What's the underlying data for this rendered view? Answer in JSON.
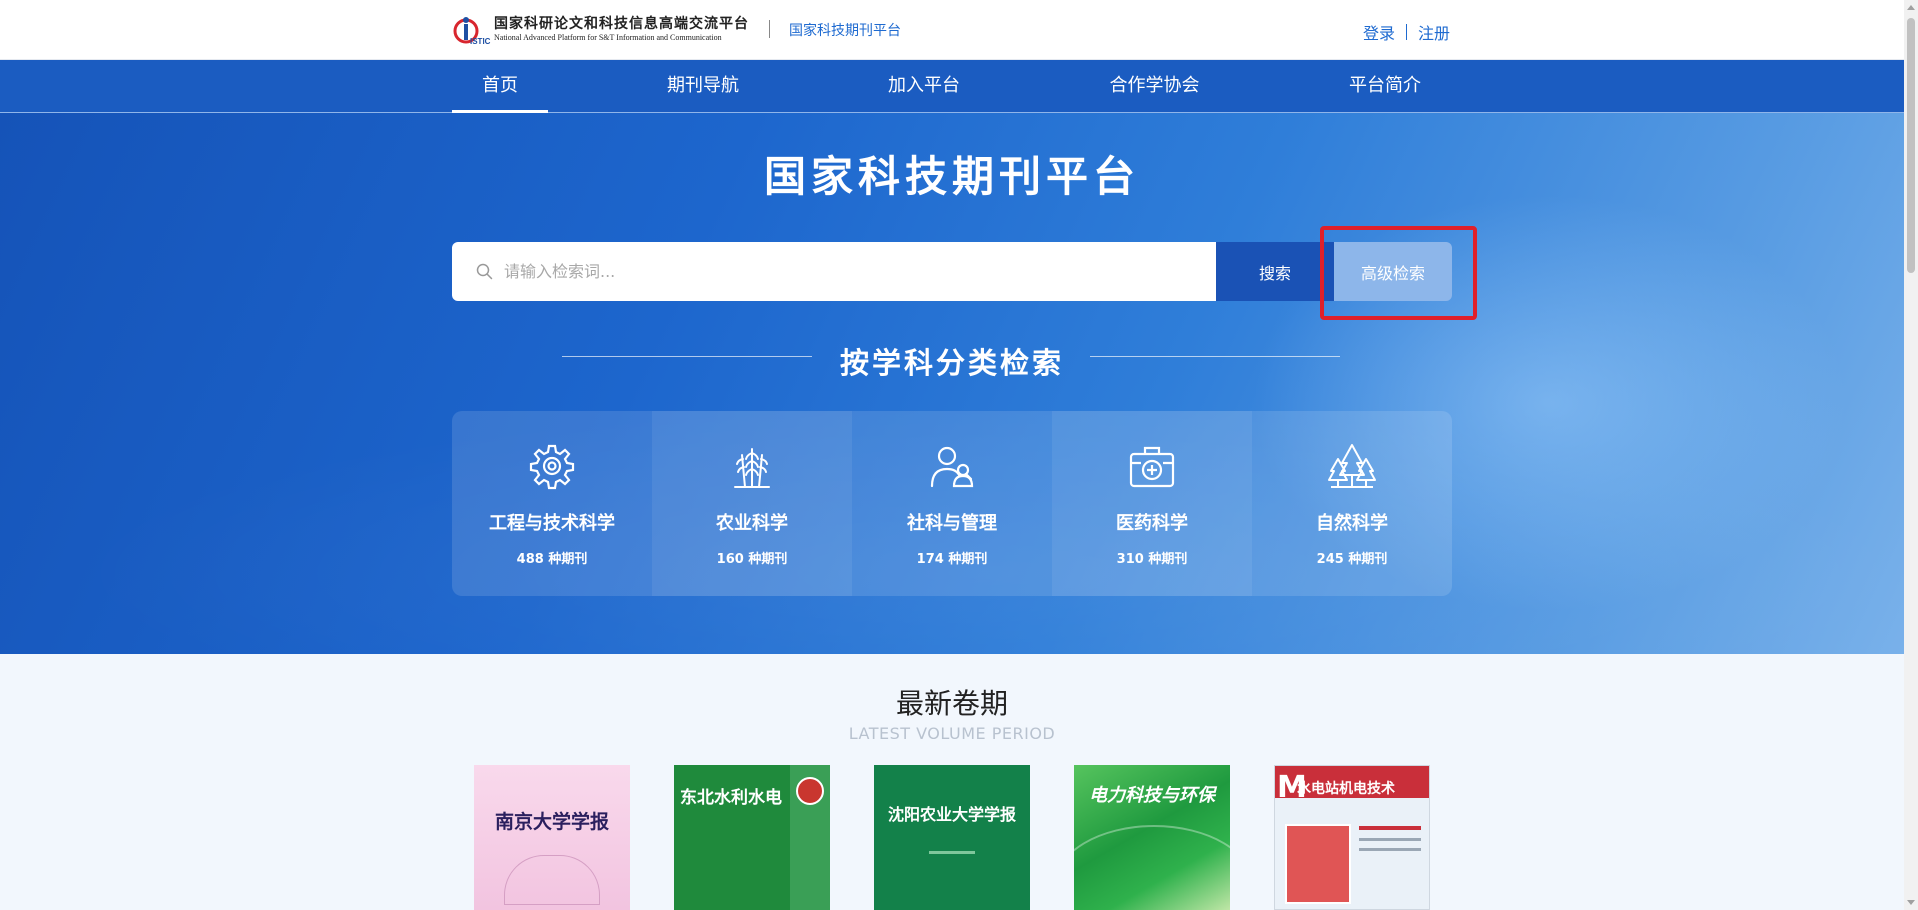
{
  "header": {
    "logo_cn": "国家科研论文和科技信息高端交流平台",
    "logo_en": "National Advanced Platform for S&T Information and Communication",
    "logo_mark": "ISTIC",
    "platform_link": "国家科技期刊平台",
    "login": "登录",
    "register": "注册"
  },
  "nav": {
    "items": [
      "首页",
      "期刊导航",
      "加入平台",
      "合作学协会",
      "平台简介"
    ],
    "active": "首页"
  },
  "hero": {
    "title": "国家科技期刊平台",
    "search_placeholder": "请输入检索词...",
    "search_button": "搜索",
    "advanced_button": "高级检索",
    "subject_heading": "按学科分类检索"
  },
  "categories": [
    {
      "icon": "gear-icon",
      "name": "工程与技术科学",
      "count": "488 种期刊"
    },
    {
      "icon": "wheat-icon",
      "name": "农业科学",
      "count": "160 种期刊"
    },
    {
      "icon": "people-icon",
      "name": "社科与管理",
      "count": "174 种期刊"
    },
    {
      "icon": "medical-kit-icon",
      "name": "医药科学",
      "count": "310 种期刊"
    },
    {
      "icon": "trees-icon",
      "name": "自然科学",
      "count": "245 种期刊"
    }
  ],
  "latest": {
    "title": "最新卷期",
    "subtitle": "LATEST VOLUME PERIOD",
    "covers": [
      {
        "title": "南京大学学报",
        "bg": "#f6cde6"
      },
      {
        "title": "东北水利水电",
        "bg": "#1f8a3c"
      },
      {
        "title": "沈阳农业大学学报",
        "bg": "#13814a"
      },
      {
        "title": "电力科技与环保",
        "bg": "#2fa84a"
      },
      {
        "title": "水电站机电技术",
        "bg": "#eaf1f8"
      }
    ]
  },
  "colors": {
    "brand_blue": "#1b5cc1",
    "highlight_red": "#e0202a",
    "link_blue": "#1e6ad0"
  }
}
